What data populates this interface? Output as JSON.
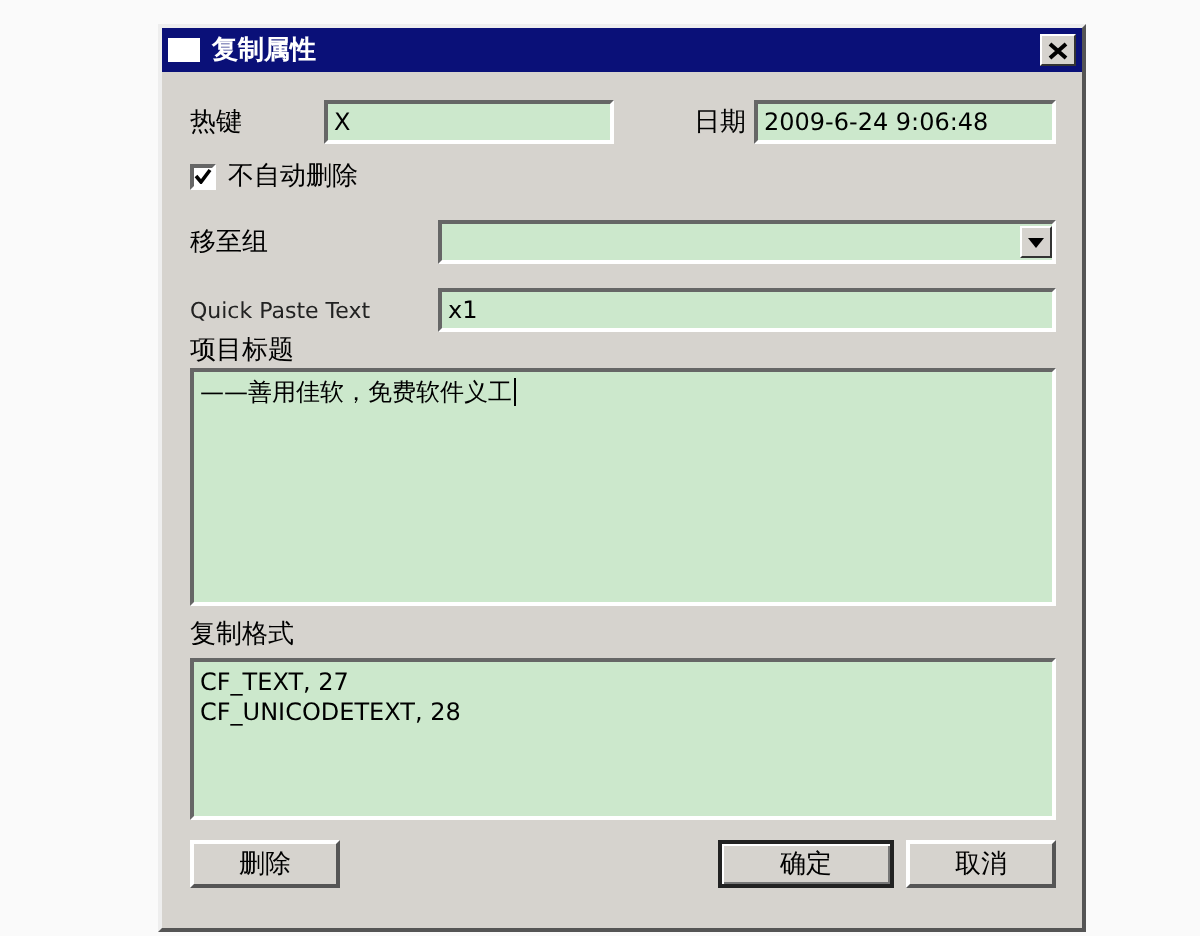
{
  "window": {
    "title": "复制属性"
  },
  "hotkey": {
    "label": "热键",
    "value": "X"
  },
  "date": {
    "label": "日期",
    "value": "2009-6-24 9:06:48"
  },
  "no_auto_delete": {
    "label": "不自动删除",
    "checked": true
  },
  "move_to_group": {
    "label": "移至组"
  },
  "quick_paste": {
    "label": "Quick Paste Text",
    "value": "x1"
  },
  "item_title": {
    "label": "项目标题",
    "value": "——善用佳软，免费软件义工"
  },
  "copy_formats": {
    "label": "复制格式",
    "items": [
      "CF_TEXT, 27",
      "CF_UNICODETEXT, 28"
    ]
  },
  "buttons": [
    {
      "label": "删除",
      "default": false
    },
    {
      "label": "确定",
      "default": true
    },
    {
      "label": "取消",
      "default": false
    }
  ]
}
